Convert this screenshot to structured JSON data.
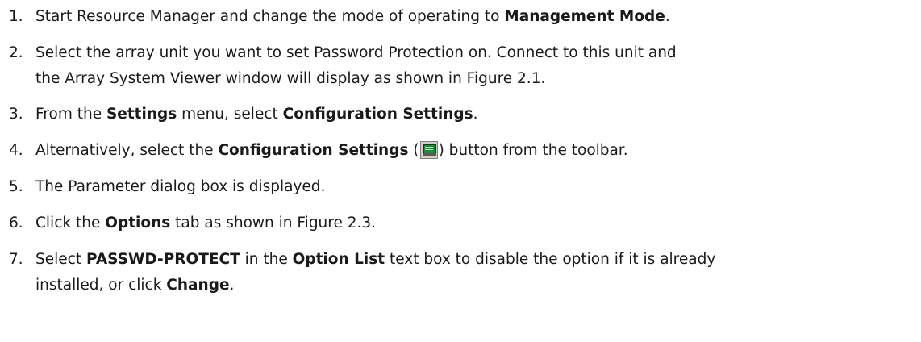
{
  "steps": [
    {
      "num": "1.",
      "parts": [
        "Start Resource Manager and change the mode of operating to ",
        "Management Mode",
        "."
      ]
    },
    {
      "num": "2.",
      "line1": "Select the array unit you want to set Password Protection on. Connect to this unit and",
      "line2": "the Array System Viewer window will display as shown in Figure 2.1."
    },
    {
      "num": "3.",
      "parts": [
        "From the ",
        "Settings",
        " menu, select ",
        "Configuration Settings",
        "."
      ]
    },
    {
      "num": "4.",
      "parts": [
        "Alternatively, select the ",
        "Configuration Settings",
        " (",
        ") button from the toolbar."
      ],
      "icon": "configuration-settings-icon"
    },
    {
      "num": "5.",
      "parts": [
        "The Parameter dialog box is displayed."
      ]
    },
    {
      "num": "6.",
      "parts": [
        "Click the ",
        "Options",
        " tab as shown in Figure 2.3."
      ]
    },
    {
      "num": "7.",
      "line1_parts": [
        "Select ",
        "PASSWD-PROTECT",
        " in the ",
        "Option List",
        " text box to disable the option if it is already"
      ],
      "line2_parts": [
        "installed, or click ",
        "Change",
        "."
      ]
    }
  ]
}
